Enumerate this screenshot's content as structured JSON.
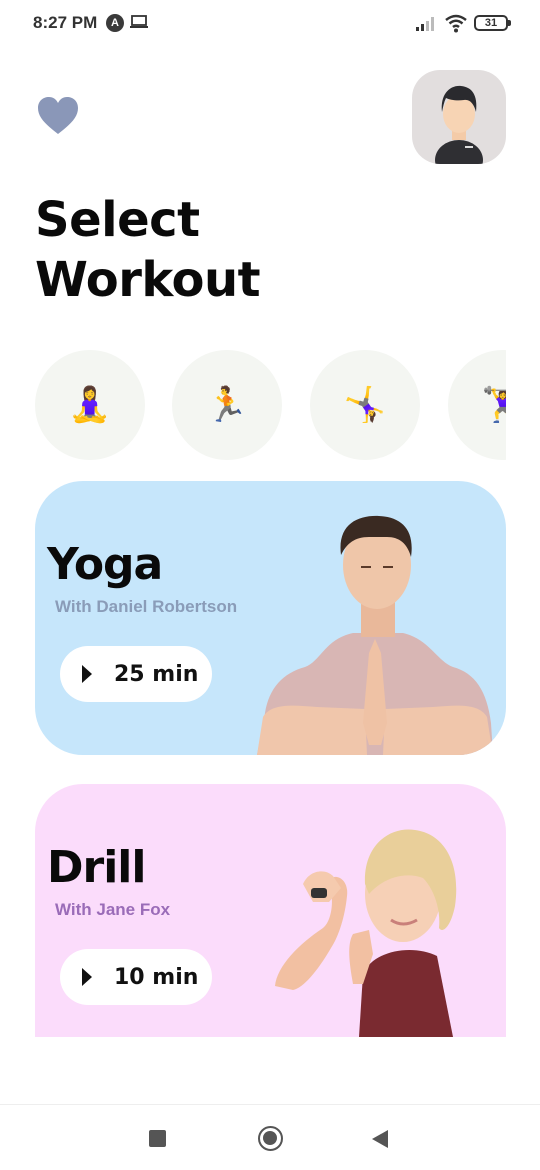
{
  "status_bar": {
    "time": "8:27 PM",
    "app_indicator": "A",
    "battery": "31"
  },
  "header": {
    "favorite_icon": "heart-icon",
    "avatar_icon": "user-avatar-icon",
    "title_line1": "Select",
    "title_line2": "Workout"
  },
  "categories": [
    {
      "name": "meditation",
      "emoji": "🧘‍♀️"
    },
    {
      "name": "running",
      "emoji": "🏃"
    },
    {
      "name": "gymnastics",
      "emoji": "🤸‍♀️"
    },
    {
      "name": "weightlifting",
      "emoji": "🏋️‍♀️"
    }
  ],
  "workouts": [
    {
      "title": "Yoga",
      "instructor": "With Daniel Robertson",
      "duration": "25 min",
      "color": "#c6e6fb"
    },
    {
      "title": "Drill",
      "instructor": "With Jane Fox",
      "duration": "10 min",
      "color": "#fbdcfb"
    }
  ],
  "nav": {
    "recents_icon": "square-icon",
    "home_icon": "circle-home-icon",
    "back_icon": "triangle-back-icon"
  },
  "colors": {
    "heart": "#8a97b8",
    "yoga_card": "#c6e6fb",
    "drill_card": "#fbdcfb",
    "yoga_subtitle": "#8a9cb8",
    "drill_subtitle": "#9a6cb8"
  }
}
